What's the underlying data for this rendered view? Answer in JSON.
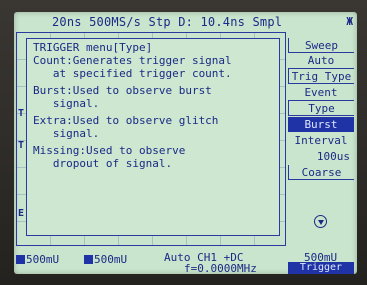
{
  "status": {
    "text": "20ns  500MS/s Stp D: 10.4ns Smpl",
    "glyph": "Ж"
  },
  "popup": {
    "lines": [
      "TRIGGER menu[Type]",
      "Count:Generates trigger signal",
      "   at specified trigger count.",
      "Burst:Used to observe burst",
      "   signal.",
      "Extra:Used to observe glitch",
      "   signal.",
      "Missing:Used to observe",
      "   dropout of signal."
    ]
  },
  "side_markers": [
    "T",
    "T",
    "E"
  ],
  "menu": {
    "items": [
      "Sweep",
      "Auto",
      "Trig Type",
      "Event",
      "Type",
      "Burst",
      "Interval",
      "100us",
      "Coarse"
    ],
    "selected_index": 5,
    "down_icon": "circle-down-arrow-icon"
  },
  "bottom": {
    "ch1": "500mU",
    "ch2": "500mU",
    "trigger_info": "Auto  CH1 +DC",
    "frequency": "f=0.0000MHz",
    "volts_div": "500mU",
    "trig_button": "Trigger"
  },
  "colors": {
    "screen": "#c9e5cd",
    "ink": "#1b2a86",
    "highlight": "#1f33a6"
  }
}
